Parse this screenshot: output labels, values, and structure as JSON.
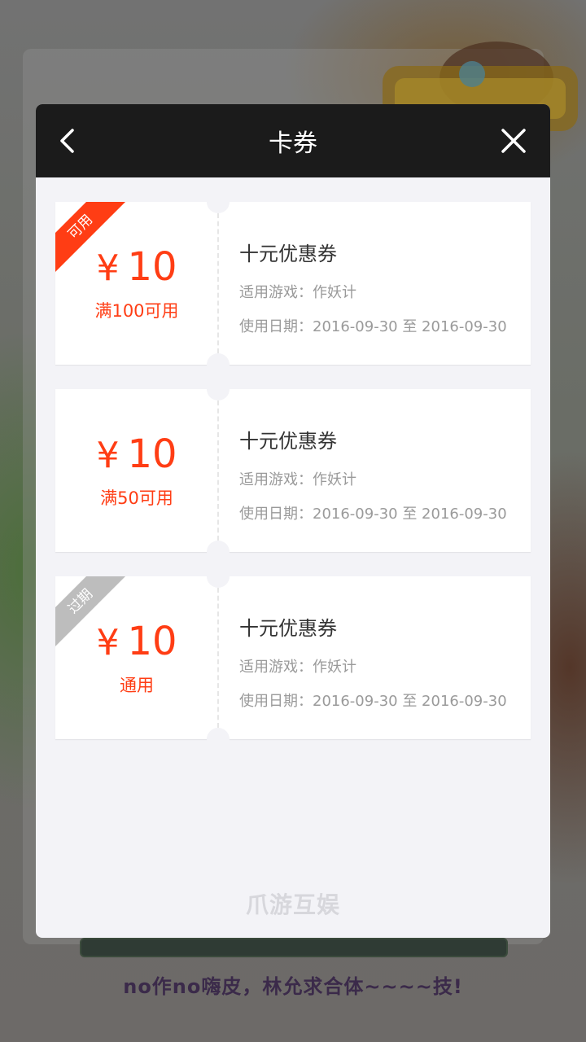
{
  "background": {
    "caption": "no作no嗨皮，林允求合体~~~~技!"
  },
  "modal": {
    "title": "卡券",
    "footer_logo": "爪游互娱"
  },
  "coupons": [
    {
      "badge": "可用",
      "amount": "10",
      "currency": "¥",
      "condition": "满100可用",
      "name": "十元优惠券",
      "game": "适用游戏：作妖计",
      "date": "使用日期：2016-09-30 至 2016-09-30"
    },
    {
      "badge": "",
      "amount": "10",
      "currency": "¥",
      "condition": "满50可用",
      "name": "十元优惠券",
      "game": "适用游戏：作妖计",
      "date": "使用日期：2016-09-30 至 2016-09-30"
    },
    {
      "badge": "过期",
      "amount": "10",
      "currency": "¥",
      "condition": "通用",
      "name": "十元优惠券",
      "game": "适用游戏：作妖计",
      "date": "使用日期：2016-09-30 至 2016-09-30"
    }
  ],
  "colors": {
    "accent": "#ff3d14",
    "header": "#1b1b1b",
    "expired": "#bdbdbd"
  },
  "icons": {
    "back": "chevron-left-icon",
    "close": "close-icon"
  }
}
